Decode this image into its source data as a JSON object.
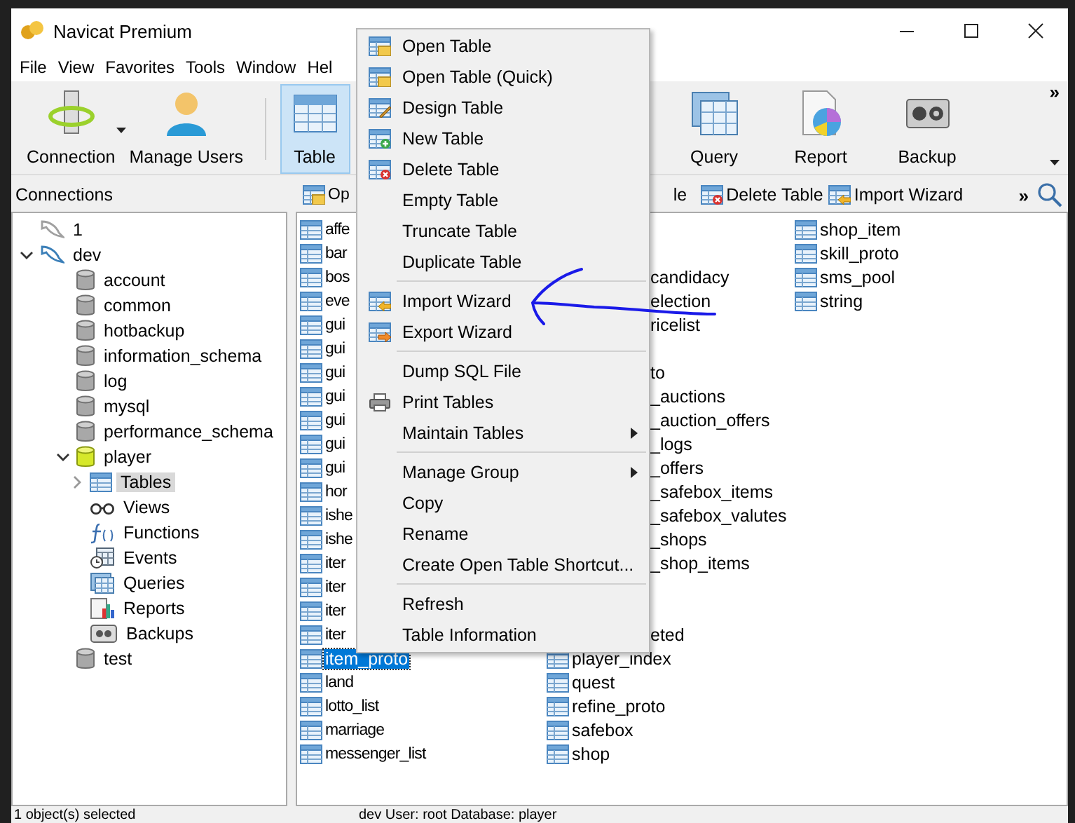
{
  "window": {
    "title": "Navicat Premium"
  },
  "menu_bar": [
    "File",
    "View",
    "Favorites",
    "Tools",
    "Window",
    "Hel"
  ],
  "toolbar": [
    {
      "label": "Connection",
      "selected": false,
      "dropdown": true
    },
    {
      "label": "Manage Users",
      "selected": false,
      "dropdown": false
    },
    {
      "label": "Table",
      "selected": true,
      "dropdown": false
    },
    {
      "label": "Query",
      "selected": false,
      "dropdown": false
    },
    {
      "label": "Report",
      "selected": false,
      "dropdown": false
    },
    {
      "label": "Backup",
      "selected": false,
      "dropdown": false
    }
  ],
  "toolbar_overflow": "»",
  "connections_header": "Connections",
  "object_toolbar": [
    {
      "label": "Op",
      "icon": true
    },
    {
      "label": "le",
      "icon": false
    },
    {
      "label": "Delete Table",
      "icon": true
    },
    {
      "label": "Import Wizard",
      "icon": true
    }
  ],
  "object_toolbar_overflow": "»",
  "tree": [
    {
      "label": "1",
      "kind": "connection",
      "expanded": false,
      "selected": false
    },
    {
      "label": "dev",
      "kind": "connection",
      "expanded": true,
      "selected": false,
      "children": [
        {
          "label": "account",
          "kind": "database",
          "expanded": false,
          "selected": false
        },
        {
          "label": "common",
          "kind": "database",
          "expanded": false,
          "selected": false
        },
        {
          "label": "hotbackup",
          "kind": "database",
          "expanded": false,
          "selected": false
        },
        {
          "label": "information_schema",
          "kind": "database",
          "expanded": false,
          "selected": false
        },
        {
          "label": "log",
          "kind": "database",
          "expanded": false,
          "selected": false
        },
        {
          "label": "mysql",
          "kind": "database",
          "expanded": false,
          "selected": false
        },
        {
          "label": "performance_schema",
          "kind": "database",
          "expanded": false,
          "selected": false
        },
        {
          "label": "player",
          "kind": "database",
          "expanded": true,
          "selected": false,
          "children": [
            {
              "label": "Tables",
              "kind": "tables",
              "expanded": false,
              "selected": true
            },
            {
              "label": "Views",
              "kind": "views",
              "selected": false
            },
            {
              "label": "Functions",
              "kind": "functions",
              "selected": false
            },
            {
              "label": "Events",
              "kind": "events",
              "selected": false
            },
            {
              "label": "Queries",
              "kind": "queries",
              "selected": false
            },
            {
              "label": "Reports",
              "kind": "reports",
              "selected": false
            },
            {
              "label": "Backups",
              "kind": "backups",
              "selected": false
            }
          ]
        },
        {
          "label": "test",
          "kind": "database",
          "expanded": false,
          "selected": false
        }
      ]
    }
  ],
  "tables_column_1": [
    {
      "label": "affe",
      "selected": false
    },
    {
      "label": "bar",
      "selected": false
    },
    {
      "label": "bos",
      "selected": false
    },
    {
      "label": "eve",
      "selected": false
    },
    {
      "label": "gui",
      "selected": false
    },
    {
      "label": "gui",
      "selected": false
    },
    {
      "label": "gui",
      "selected": false
    },
    {
      "label": "gui",
      "selected": false
    },
    {
      "label": "gui",
      "selected": false
    },
    {
      "label": "gui",
      "selected": false
    },
    {
      "label": "gui",
      "selected": false
    },
    {
      "label": "hor",
      "selected": false
    },
    {
      "label": "ishe",
      "selected": false
    },
    {
      "label": "ishe",
      "selected": false
    },
    {
      "label": "iter",
      "selected": false
    },
    {
      "label": "iter",
      "selected": false
    },
    {
      "label": "iter",
      "selected": false
    },
    {
      "label": "iter",
      "selected": false
    },
    {
      "label": "item_proto",
      "selected": true
    },
    {
      "label": "land",
      "selected": false
    },
    {
      "label": "lotto_list",
      "selected": false
    },
    {
      "label": "marriage",
      "selected": false
    },
    {
      "label": "messenger_list",
      "selected": false
    }
  ],
  "tables_column_2": [
    {
      "items": [
        {
          "label": "candidacy",
          "kind": "fragment"
        },
        {
          "label": "election",
          "kind": "fragment"
        },
        {
          "label": "ricelist",
          "kind": "fragment"
        }
      ]
    },
    {
      "items": [
        {
          "label": "to",
          "kind": "fragment"
        },
        {
          "label": "_auctions",
          "kind": "fragment"
        },
        {
          "label": "_auction_offers",
          "kind": "fragment"
        },
        {
          "label": "_logs",
          "kind": "fragment"
        },
        {
          "label": "_offers",
          "kind": "fragment"
        },
        {
          "label": "_safebox_items",
          "kind": "fragment"
        },
        {
          "label": "_safebox_valutes",
          "kind": "fragment"
        },
        {
          "label": "_shops",
          "kind": "fragment"
        },
        {
          "label": "_shop_items",
          "kind": "fragment"
        }
      ]
    },
    {
      "items": [
        {
          "label": "eted",
          "kind": "fragment"
        },
        {
          "label": "player_index",
          "kind": "table"
        },
        {
          "label": "quest",
          "kind": "table"
        },
        {
          "label": "refine_proto",
          "kind": "table"
        },
        {
          "label": "safebox",
          "kind": "table"
        },
        {
          "label": "shop",
          "kind": "table"
        }
      ]
    }
  ],
  "tables_column_3": [
    {
      "label": "shop_item"
    },
    {
      "label": "skill_proto"
    },
    {
      "label": "sms_pool"
    },
    {
      "label": "string"
    }
  ],
  "context_menu": [
    {
      "kind": "item",
      "label": "Open Table"
    },
    {
      "kind": "item",
      "label": "Open Table (Quick)"
    },
    {
      "kind": "item",
      "label": "Design Table"
    },
    {
      "kind": "item",
      "label": "New Table"
    },
    {
      "kind": "item",
      "label": "Delete Table"
    },
    {
      "kind": "item",
      "label": "Empty Table"
    },
    {
      "kind": "item",
      "label": "Truncate Table"
    },
    {
      "kind": "item",
      "label": "Duplicate Table"
    },
    {
      "kind": "separator"
    },
    {
      "kind": "item",
      "label": "Import Wizard"
    },
    {
      "kind": "item",
      "label": "Export Wizard"
    },
    {
      "kind": "separator"
    },
    {
      "kind": "item",
      "label": "Dump SQL File"
    },
    {
      "kind": "item",
      "label": "Print Tables"
    },
    {
      "kind": "submenu",
      "label": "Maintain Tables"
    },
    {
      "kind": "separator"
    },
    {
      "kind": "submenu",
      "label": "Manage Group"
    },
    {
      "kind": "item",
      "label": "Copy"
    },
    {
      "kind": "item",
      "label": "Rename"
    },
    {
      "kind": "item",
      "label": "Create Open Table Shortcut..."
    },
    {
      "kind": "separator"
    },
    {
      "kind": "item",
      "label": "Refresh"
    },
    {
      "kind": "item",
      "label": "Table Information"
    }
  ],
  "status_bar": {
    "selection": "1 object(s) selected",
    "connection": "dev  User: root  Database: player"
  }
}
